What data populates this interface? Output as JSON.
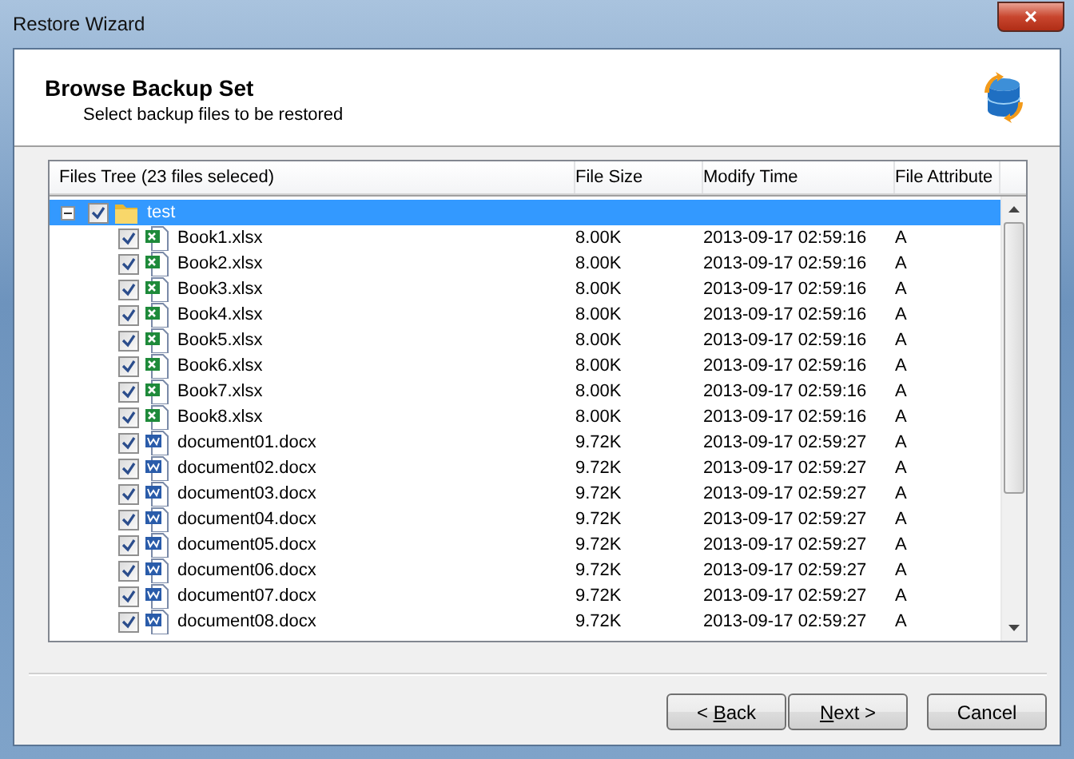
{
  "window": {
    "title": "Restore Wizard",
    "close": "×"
  },
  "header": {
    "title": "Browse Backup Set",
    "subtitle": "Select backup files to be restored"
  },
  "table": {
    "columns": [
      "Files Tree (23 files seleced)",
      "File Size",
      "Modify Time",
      "File Attribute"
    ],
    "rows": [
      {
        "kind": "folder",
        "name": "test",
        "expanded": true,
        "checked": true,
        "selected": true,
        "children": [
          {
            "kind": "excel",
            "name": "Book1.xlsx",
            "size": "8.00K",
            "time": "2013-09-17 02:59:16",
            "attribute": "A",
            "checked": true,
            "selected": false
          },
          {
            "kind": "excel",
            "name": "Book2.xlsx",
            "size": "8.00K",
            "time": "2013-09-17 02:59:16",
            "attribute": "A",
            "checked": true,
            "selected": false
          },
          {
            "kind": "excel",
            "name": "Book3.xlsx",
            "size": "8.00K",
            "time": "2013-09-17 02:59:16",
            "attribute": "A",
            "checked": true,
            "selected": false
          },
          {
            "kind": "excel",
            "name": "Book4.xlsx",
            "size": "8.00K",
            "time": "2013-09-17 02:59:16",
            "attribute": "A",
            "checked": true,
            "selected": false
          },
          {
            "kind": "excel",
            "name": "Book5.xlsx",
            "size": "8.00K",
            "time": "2013-09-17 02:59:16",
            "attribute": "A",
            "checked": true,
            "selected": false
          },
          {
            "kind": "excel",
            "name": "Book6.xlsx",
            "size": "8.00K",
            "time": "2013-09-17 02:59:16",
            "attribute": "A",
            "checked": true,
            "selected": false
          },
          {
            "kind": "excel",
            "name": "Book7.xlsx",
            "size": "8.00K",
            "time": "2013-09-17 02:59:16",
            "attribute": "A",
            "checked": true,
            "selected": false
          },
          {
            "kind": "excel",
            "name": "Book8.xlsx",
            "size": "8.00K",
            "time": "2013-09-17 02:59:16",
            "attribute": "A",
            "checked": true,
            "selected": false
          },
          {
            "kind": "word",
            "name": "document01.docx",
            "size": "9.72K",
            "time": "2013-09-17 02:59:27",
            "attribute": "A",
            "checked": true,
            "selected": false
          },
          {
            "kind": "word",
            "name": "document02.docx",
            "size": "9.72K",
            "time": "2013-09-17 02:59:27",
            "attribute": "A",
            "checked": true,
            "selected": false
          },
          {
            "kind": "word",
            "name": "document03.docx",
            "size": "9.72K",
            "time": "2013-09-17 02:59:27",
            "attribute": "A",
            "checked": true,
            "selected": false
          },
          {
            "kind": "word",
            "name": "document04.docx",
            "size": "9.72K",
            "time": "2013-09-17 02:59:27",
            "attribute": "A",
            "checked": true,
            "selected": false
          },
          {
            "kind": "word",
            "name": "document05.docx",
            "size": "9.72K",
            "time": "2013-09-17 02:59:27",
            "attribute": "A",
            "checked": true,
            "selected": false
          },
          {
            "kind": "word",
            "name": "document06.docx",
            "size": "9.72K",
            "time": "2013-09-17 02:59:27",
            "attribute": "A",
            "checked": true,
            "selected": false
          },
          {
            "kind": "word",
            "name": "document07.docx",
            "size": "9.72K",
            "time": "2013-09-17 02:59:27",
            "attribute": "A",
            "checked": true,
            "selected": false
          },
          {
            "kind": "word",
            "name": "document08.docx",
            "size": "9.72K",
            "time": "2013-09-17 02:59:27",
            "attribute": "A",
            "checked": true,
            "selected": false
          }
        ]
      }
    ]
  },
  "buttons": [
    {
      "before": "< ",
      "access_key": "B",
      "after": "ack"
    },
    {
      "access_key": "N",
      "after": "ext >"
    },
    {
      "before": "Cancel"
    }
  ]
}
